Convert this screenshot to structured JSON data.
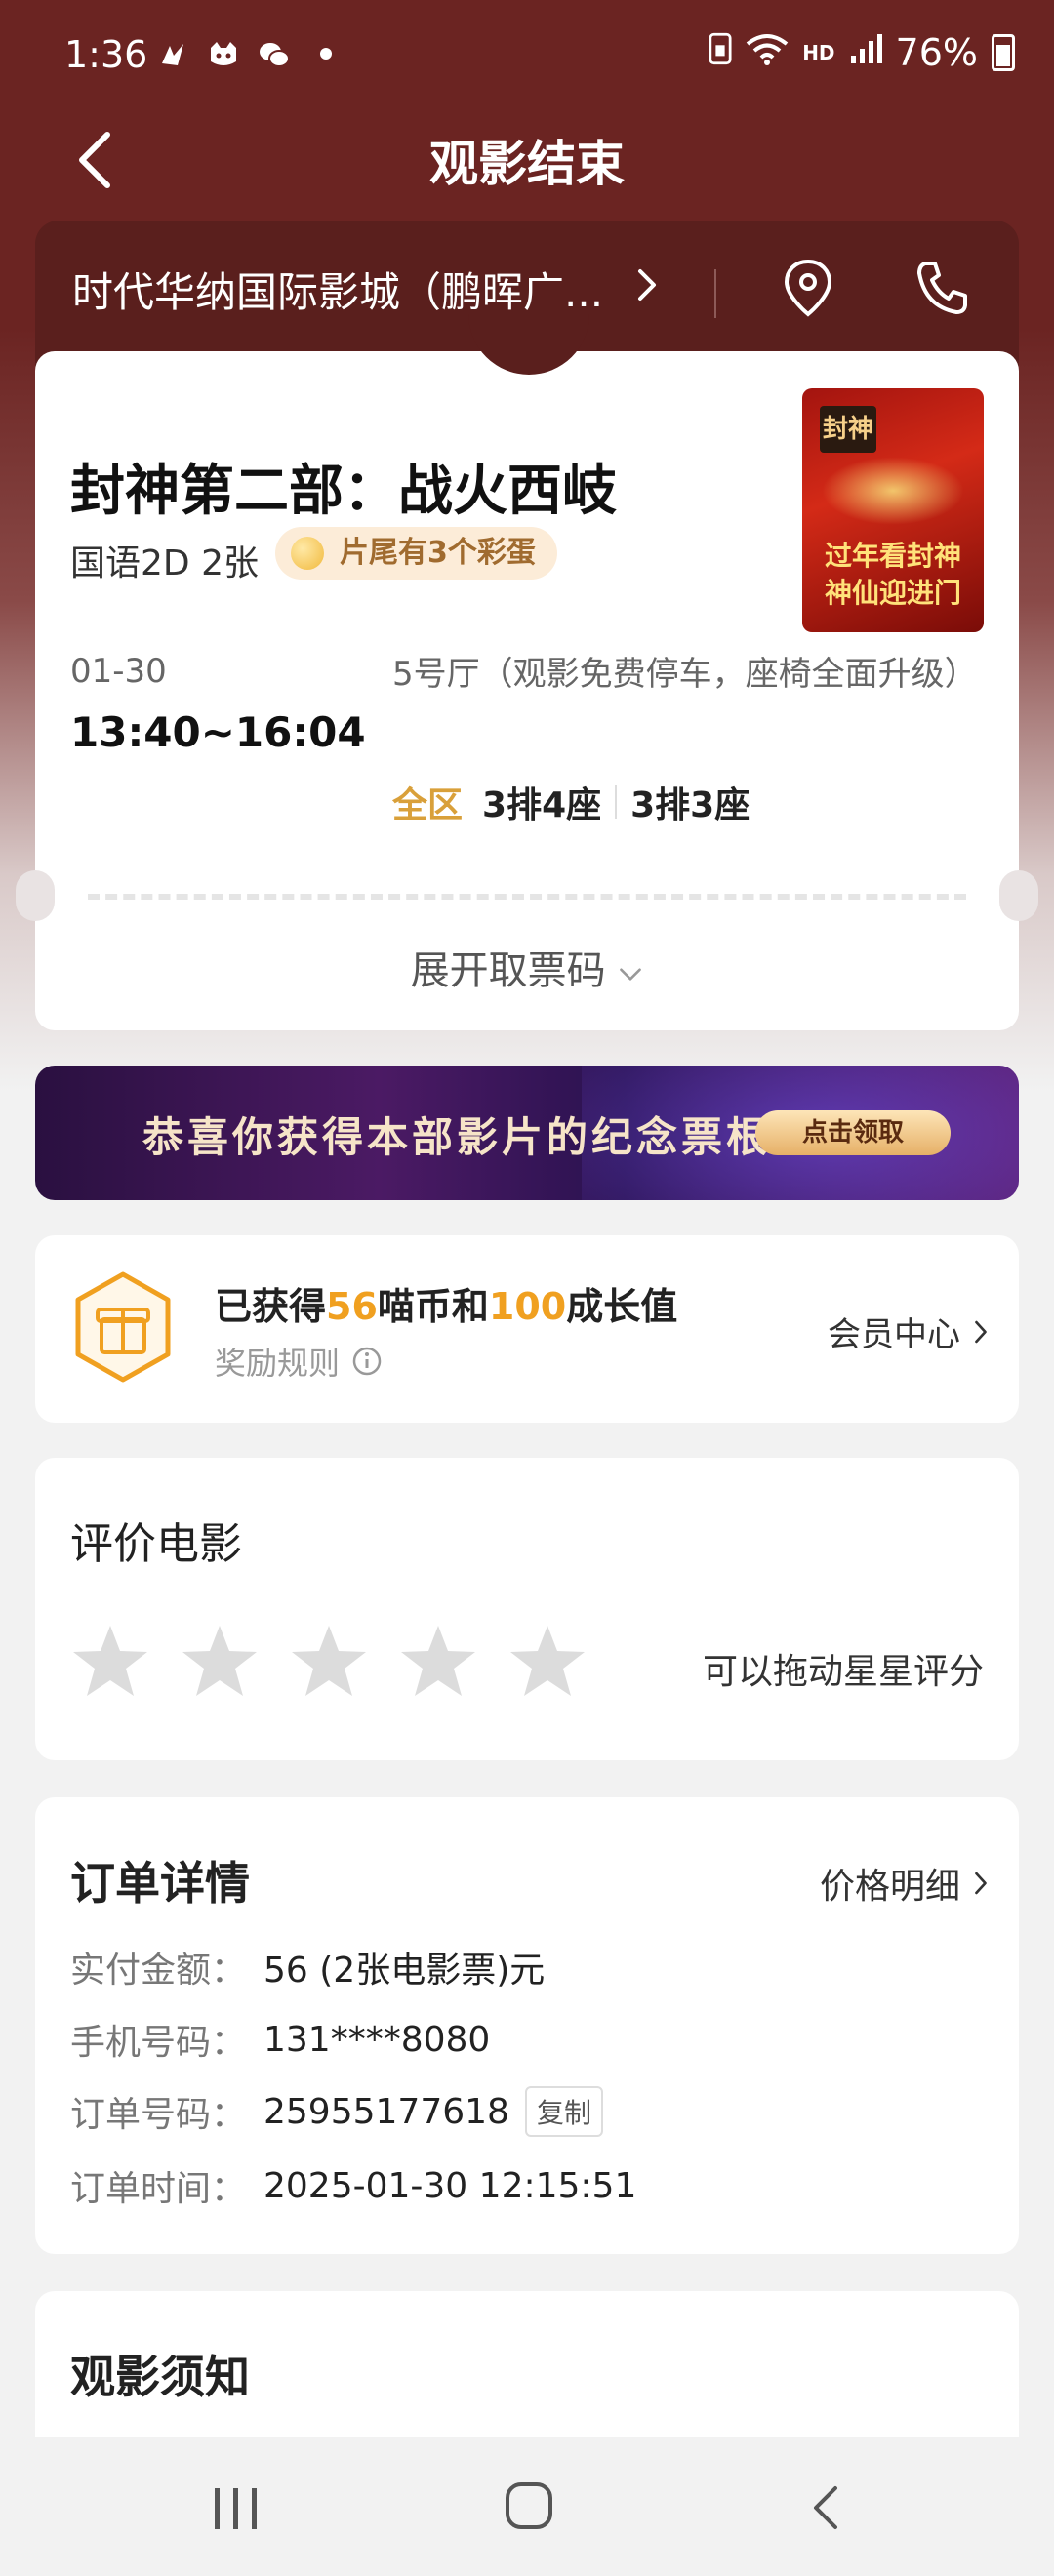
{
  "status_bar": {
    "time": "1:36",
    "battery": "76%"
  },
  "nav": {
    "title": "观影结束"
  },
  "cinema": {
    "name": "时代华纳国际影城（鹏晖广..."
  },
  "ticket": {
    "movie_title": "封神第二部：战火西岐",
    "format_count": "国语2D 2张",
    "easter_egg_badge": "片尾有3个彩蛋",
    "poster": {
      "tag": "封神",
      "line1": "过年看封神",
      "line2": "神仙迎进门"
    },
    "date": "01-30",
    "time": "13:40~16:04",
    "hall": "5号厅（观影免费停车，座椅全面升级）",
    "zone": "全区",
    "seats": [
      "3排4座",
      "3排3座"
    ],
    "expand_label": "展开取票码"
  },
  "banner": {
    "text": "恭喜你获得本部影片的纪念票根",
    "button": "点击领取"
  },
  "reward": {
    "prefix": "已获得",
    "coins": "56",
    "coins_unit": "喵币和",
    "growth": "100",
    "growth_unit": "成长值",
    "rule_label": "奖励规则",
    "member_center": "会员中心"
  },
  "rating": {
    "title": "评价电影",
    "hint": "可以拖动星星评分",
    "stars_max": 5,
    "stars_selected": 0
  },
  "order": {
    "title": "订单详情",
    "price_detail": "价格明细",
    "rows": [
      {
        "label": "实付金额：",
        "value": "56 (2张电影票)元"
      },
      {
        "label": "手机号码：",
        "value": "131****8080"
      },
      {
        "label": "订单号码：",
        "value": "25955177618"
      },
      {
        "label": "订单时间：",
        "value": "2025-01-30 12:15:51"
      }
    ],
    "copy_label": "复制"
  },
  "notice": {
    "title": "观影须知"
  },
  "colors": {
    "header_bg": "#6b2422",
    "cinema_bar_bg": "#5a1f1d",
    "accent_gold": "#f0a020",
    "zone_gold": "#d9a03a"
  }
}
